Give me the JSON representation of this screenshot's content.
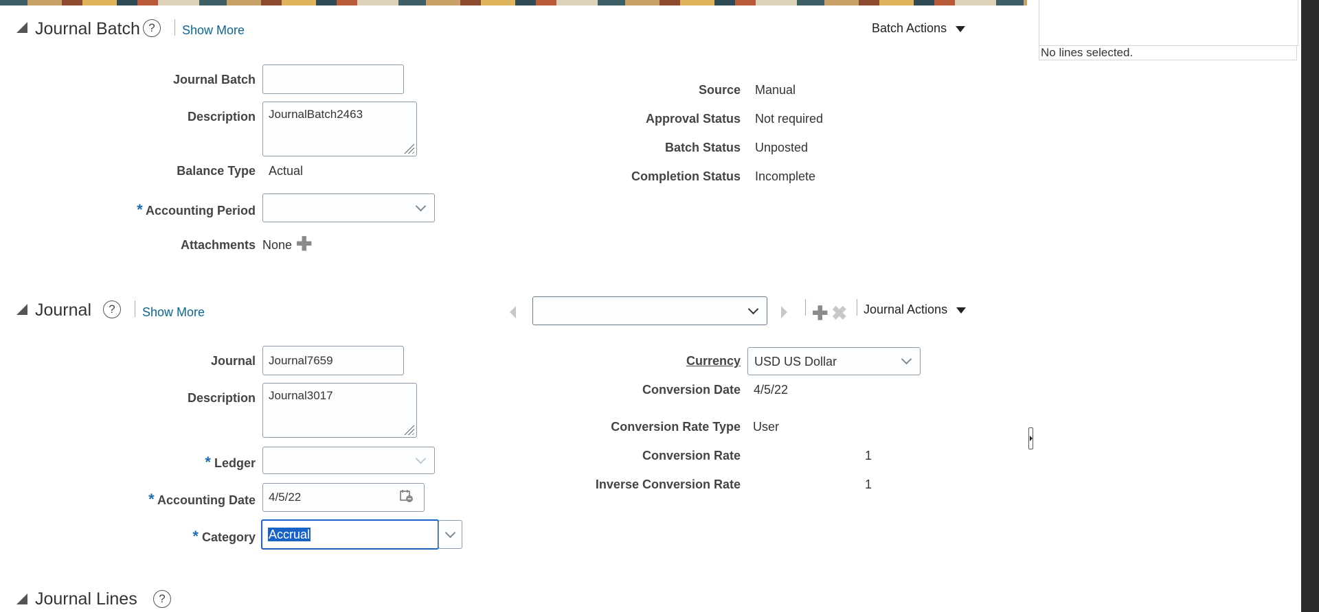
{
  "side_panel": {
    "status_text": "No lines selected."
  },
  "batch_section": {
    "title": "Journal Batch",
    "show_more": "Show More",
    "actions_label": "Batch Actions",
    "fields": {
      "journal_batch_label": "Journal Batch",
      "journal_batch_value": "",
      "description_label": "Description",
      "description_value": "JournalBatch2463",
      "balance_type_label": "Balance Type",
      "balance_type_value": "Actual",
      "accounting_period_label": "Accounting Period",
      "accounting_period_value": "",
      "attachments_label": "Attachments",
      "attachments_value": "None",
      "source_label": "Source",
      "source_value": "Manual",
      "approval_status_label": "Approval Status",
      "approval_status_value": "Not required",
      "batch_status_label": "Batch Status",
      "batch_status_value": "Unposted",
      "completion_status_label": "Completion Status",
      "completion_status_value": "Incomplete"
    }
  },
  "journal_section": {
    "title": "Journal",
    "show_more": "Show More",
    "actions_label": "Journal Actions",
    "journal_selector_value": "",
    "fields": {
      "journal_label": "Journal",
      "journal_value": "Journal7659",
      "description_label": "Description",
      "description_value": "Journal3017",
      "ledger_label": "Ledger",
      "ledger_value": "",
      "accounting_date_label": "Accounting Date",
      "accounting_date_value": "4/5/22",
      "category_label": "Category",
      "category_value": "Accrual",
      "currency_label": "Currency",
      "currency_value": "USD US Dollar",
      "conversion_date_label": "Conversion Date",
      "conversion_date_value": "4/5/22",
      "conversion_rate_type_label": "Conversion Rate Type",
      "conversion_rate_type_value": "User",
      "conversion_rate_label": "Conversion Rate",
      "conversion_rate_value": "1",
      "inverse_conversion_rate_label": "Inverse Conversion Rate",
      "inverse_conversion_rate_value": "1"
    }
  },
  "lines_section": {
    "title": "Journal Lines"
  },
  "required_marker": "*",
  "help_glyph": "?",
  "icons": {
    "plus": "plus-icon",
    "delete": "close-icon",
    "calendar": "calendar-icon",
    "help": "help-icon",
    "collapse": "collapse-triangle-icon"
  },
  "colors": {
    "link": "#0b6592",
    "required": "#1f6eb4",
    "selection": "#1a63c6",
    "focus_border": "#1a63c6"
  }
}
